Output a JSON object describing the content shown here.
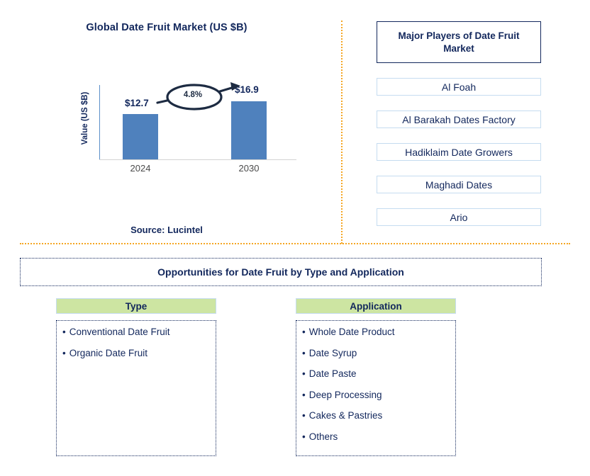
{
  "chart_data": {
    "type": "bar",
    "title": "Global Date Fruit Market (US $B)",
    "xlabel": "",
    "ylabel": "Value (US $B)",
    "categories": [
      "2024",
      "2030"
    ],
    "values": [
      12.7,
      16.9
    ],
    "value_labels": [
      "$12.7",
      "$16.9"
    ],
    "ylim": [
      0,
      19
    ],
    "grid": false,
    "legend": "none",
    "annotation": "4.8%",
    "annotation_meaning": "CAGR from 2024 to 2030",
    "bar_color": "#4f81bd",
    "source": "Source: Lucintel"
  },
  "chart_panel": {
    "title": "Global Date Fruit Market (US $B)",
    "y_axis_label": "Value (US $B)",
    "cagr": "4.8%",
    "bars": [
      {
        "label": "2024",
        "value_label": "$12.7"
      },
      {
        "label": "2030",
        "value_label": "$16.9"
      }
    ],
    "source": "Source: Lucintel"
  },
  "players_panel": {
    "header": "Major Players of Date Fruit Market",
    "items": [
      {
        "name": "Al Foah"
      },
      {
        "name": "Al Barakah Dates Factory"
      },
      {
        "name": "Hadiklaim Date Growers"
      },
      {
        "name": "Maghadi Dates"
      },
      {
        "name": "Ario"
      }
    ]
  },
  "opportunities": {
    "banner": "Opportunities for Date Fruit by Type and Application",
    "columns": [
      {
        "header": "Type",
        "items": [
          "Conventional Date Fruit",
          "Organic Date Fruit"
        ]
      },
      {
        "header": "Application",
        "items": [
          "Whole Date Product",
          "Date Syrup",
          "Date Paste",
          "Deep Processing",
          "Cakes & Pastries",
          "Others"
        ]
      }
    ]
  },
  "colors": {
    "bar": "#4f81bd",
    "navy": "#12275c",
    "header_green": "#cde5a2",
    "divider_orange": "#f5a623",
    "box_border_blue": "#c5dcf0"
  },
  "bullet": "•"
}
